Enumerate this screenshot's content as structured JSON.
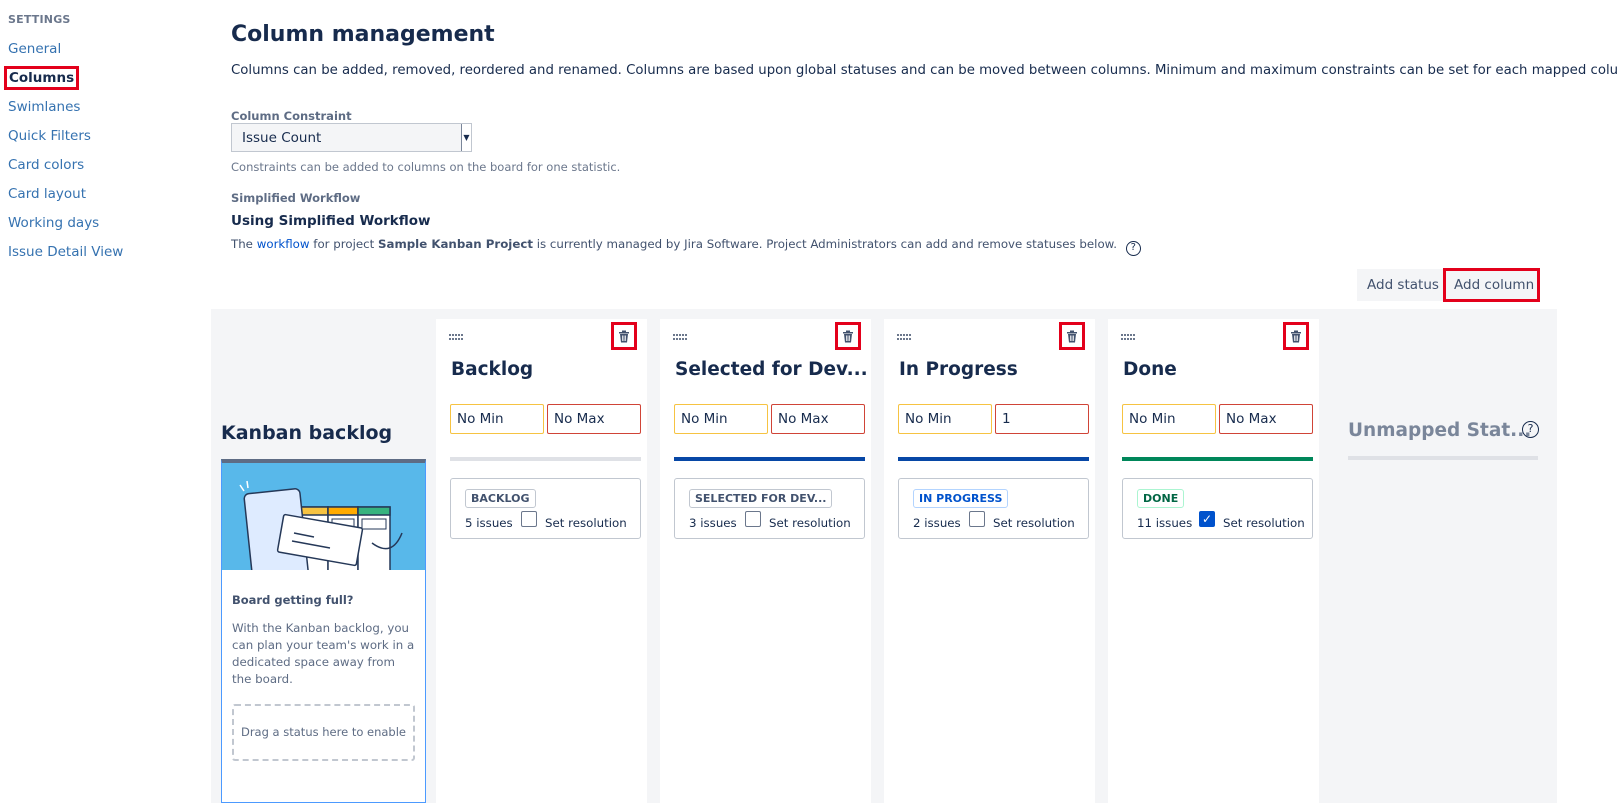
{
  "sidebar": {
    "heading": "SETTINGS",
    "items": [
      {
        "label": "General"
      },
      {
        "label": "Columns"
      },
      {
        "label": "Swimlanes"
      },
      {
        "label": "Quick Filters"
      },
      {
        "label": "Card colors"
      },
      {
        "label": "Card layout"
      },
      {
        "label": "Working days"
      },
      {
        "label": "Issue Detail View"
      }
    ]
  },
  "main": {
    "title": "Column management",
    "description": "Columns can be added, removed, reordered and renamed. Columns are based upon global statuses and can be moved between columns. Minimum and maximum constraints can be set for each mapped column.",
    "constraint_label": "Column Constraint",
    "constraint_value": "Issue Count",
    "constraint_help": "Constraints can be added to columns on the board for one statistic.",
    "workflow_label": "Simplified Workflow",
    "workflow_title": "Using Simplified Workflow",
    "workflow_desc_prefix": "The ",
    "workflow_link": "workflow",
    "workflow_desc_mid": " for project ",
    "workflow_project": "Sample Kanban Project",
    "workflow_desc_suffix": " is currently managed by Jira Software. Project Administrators can add and remove statuses below.",
    "add_status": "Add status",
    "add_column": "Add column"
  },
  "backlog": {
    "title": "Kanban backlog",
    "heading": "Board getting full?",
    "text": "With the Kanban backlog, you can plan your team's work in a dedicated space away from the board.",
    "drag_text": "Drag a status here to enable"
  },
  "columns": [
    {
      "name": "Backlog",
      "min": "No Min",
      "max": "No Max",
      "bar_color": "#dfe1e6",
      "status": "BACKLOG",
      "status_color": "#42526e",
      "status_border": "#c1c7d0",
      "issues": "5 issues",
      "resolution": "Set resolution",
      "checked": false
    },
    {
      "name": "Selected for Dev...",
      "min": "No Min",
      "max": "No Max",
      "bar_color": "#0747a6",
      "status": "SELECTED FOR DEV...",
      "status_color": "#42526e",
      "status_border": "#c1c7d0",
      "issues": "3 issues",
      "resolution": "Set resolution",
      "checked": false
    },
    {
      "name": "In Progress",
      "min": "No Min",
      "max": "1",
      "bar_color": "#0747a6",
      "status": "IN PROGRESS",
      "status_color": "#0052cc",
      "status_border": "#b3d4ff",
      "issues": "2 issues",
      "resolution": "Set resolution",
      "checked": false
    },
    {
      "name": "Done",
      "min": "No Min",
      "max": "No Max",
      "bar_color": "#00875a",
      "status": "DONE",
      "status_color": "#006644",
      "status_border": "#abf5d1",
      "issues": "11 issues",
      "resolution": "Set resolution",
      "checked": true
    }
  ],
  "unmapped": {
    "title": "Unmapped Stat..."
  },
  "icons": {
    "help": "question-circle-icon",
    "delete": "trash-icon",
    "drag": "drag-handle-icon",
    "check": "checkmark-icon"
  },
  "colors": {
    "highlight": "#e3001b",
    "link": "#3572b0",
    "board_bg": "#f4f5f7"
  }
}
